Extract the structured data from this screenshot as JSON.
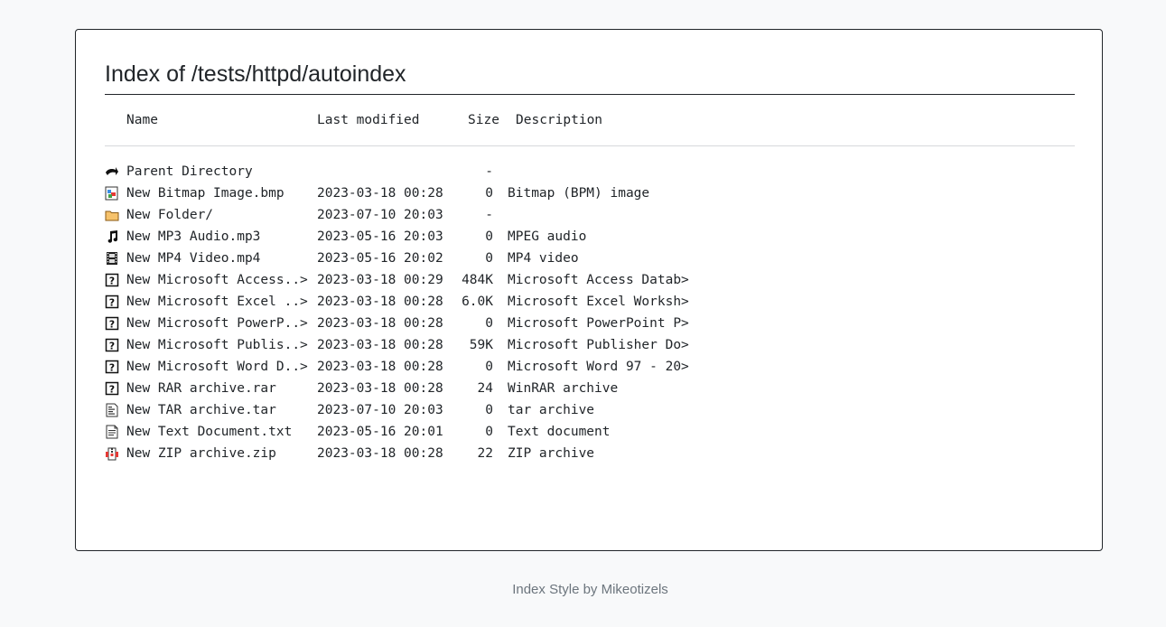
{
  "page": {
    "title": "Index of /tests/httpd/autoindex",
    "footer": "Index Style by Mikeotizels"
  },
  "table": {
    "headers": {
      "name": "Name",
      "last_modified": "Last modified",
      "size": "Size",
      "description": "Description"
    },
    "rows": [
      {
        "icon": "back-icon",
        "name": "Parent Directory",
        "modified": "",
        "size": "-",
        "description": ""
      },
      {
        "icon": "image-icon",
        "name": "New Bitmap Image.bmp",
        "modified": "2023-03-18 00:28",
        "size": "0",
        "description": "Bitmap (BPM) image"
      },
      {
        "icon": "folder-icon",
        "name": "New Folder/",
        "modified": "2023-07-10 20:03",
        "size": "-",
        "description": ""
      },
      {
        "icon": "sound-icon",
        "name": "New MP3 Audio.mp3",
        "modified": "2023-05-16 20:03",
        "size": "0",
        "description": "MPEG audio"
      },
      {
        "icon": "movie-icon",
        "name": "New MP4 Video.mp4",
        "modified": "2023-05-16 20:02",
        "size": "0",
        "description": "MP4 video"
      },
      {
        "icon": "unknown-icon",
        "name": "New Microsoft Access..>",
        "modified": "2023-03-18 00:29",
        "size": "484K",
        "description": "Microsoft Access Datab>"
      },
      {
        "icon": "unknown-icon",
        "name": "New Microsoft Excel ..>",
        "modified": "2023-03-18 00:28",
        "size": "6.0K",
        "description": "Microsoft Excel Worksh>"
      },
      {
        "icon": "unknown-icon",
        "name": "New Microsoft PowerP..>",
        "modified": "2023-03-18 00:28",
        "size": "0",
        "description": "Microsoft PowerPoint P>"
      },
      {
        "icon": "unknown-icon",
        "name": "New Microsoft Publis..>",
        "modified": "2023-03-18 00:28",
        "size": "59K",
        "description": "Microsoft Publisher Do>"
      },
      {
        "icon": "unknown-icon",
        "name": "New Microsoft Word D..>",
        "modified": "2023-03-18 00:28",
        "size": "0",
        "description": "Microsoft Word 97 - 20>"
      },
      {
        "icon": "unknown-icon",
        "name": "New RAR archive.rar",
        "modified": "2023-03-18 00:28",
        "size": "24",
        "description": "WinRAR archive"
      },
      {
        "icon": "tar-icon",
        "name": "New TAR archive.tar",
        "modified": "2023-07-10 20:03",
        "size": "0",
        "description": "tar archive"
      },
      {
        "icon": "text-icon",
        "name": "New Text Document.txt",
        "modified": "2023-05-16 20:01",
        "size": "0",
        "description": "Text document"
      },
      {
        "icon": "compressed-icon",
        "name": "New ZIP archive.zip",
        "modified": "2023-03-18 00:28",
        "size": "22",
        "description": "ZIP archive"
      }
    ]
  },
  "colors": {
    "background": "#f8f9fa",
    "card": "#ffffff",
    "text": "#212529",
    "muted": "#6c757d",
    "rule": "#d6d8db"
  }
}
